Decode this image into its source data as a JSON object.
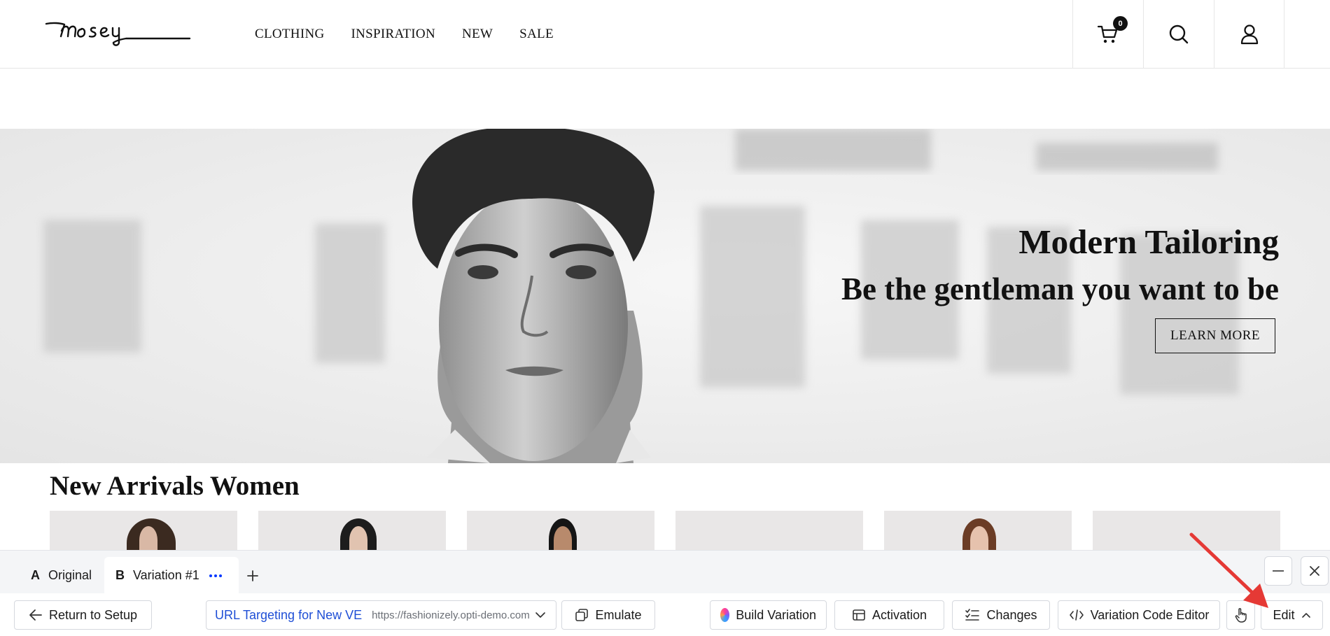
{
  "site": {
    "brand": "mosey",
    "nav": [
      "CLOTHING",
      "INSPIRATION",
      "NEW",
      "SALE"
    ],
    "cart_count": "0",
    "icons": [
      "cart-icon",
      "search-icon",
      "user-icon"
    ]
  },
  "hero": {
    "title": "Modern Tailoring",
    "subtitle": "Be the gentleman you want to be",
    "cta": "LEARN MORE"
  },
  "section": {
    "title": "New Arrivals Women"
  },
  "editor": {
    "tabs": [
      {
        "letter": "A",
        "label": "Original"
      },
      {
        "letter": "B",
        "label": "Variation #1"
      }
    ],
    "toolbar": {
      "return_label": "Return to Setup",
      "url_target_name": "URL Targeting for New VE",
      "url_target_url": "https://fashionizely.opti-demo.com",
      "emulate_label": "Emulate",
      "build_label": "Build Variation",
      "activation_label": "Activation",
      "changes_label": "Changes",
      "code_editor_label": "Variation Code Editor",
      "edit_label": "Edit"
    }
  },
  "colors": {
    "accent": "#0037ff",
    "link_blue": "#1f4fd6",
    "annotation_arrow": "#e53935"
  }
}
